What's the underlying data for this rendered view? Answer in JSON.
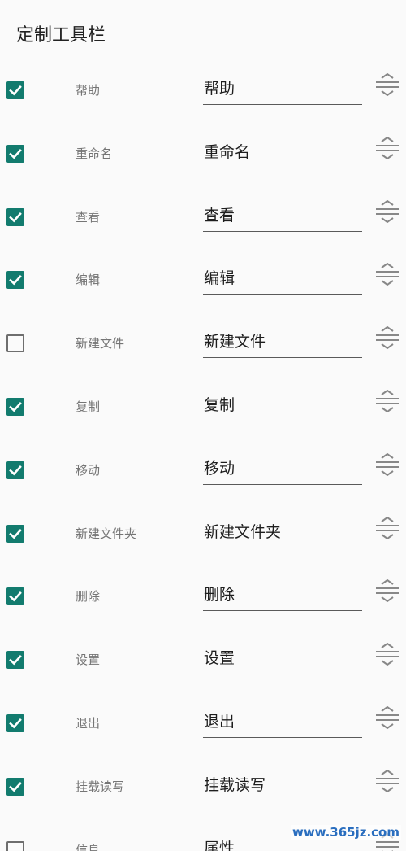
{
  "page": {
    "title": "定制工具栏"
  },
  "colors": {
    "accent": "#127b6e",
    "background": "#fafafa"
  },
  "items": [
    {
      "label": "帮助",
      "value": "帮助",
      "checked": true
    },
    {
      "label": "重命名",
      "value": "重命名",
      "checked": true
    },
    {
      "label": "查看",
      "value": "查看",
      "checked": true
    },
    {
      "label": "编辑",
      "value": "编辑",
      "checked": true
    },
    {
      "label": "新建文件",
      "value": "新建文件",
      "checked": false
    },
    {
      "label": "复制",
      "value": "复制",
      "checked": true
    },
    {
      "label": "移动",
      "value": "移动",
      "checked": true
    },
    {
      "label": "新建文件夹",
      "value": "新建文件夹",
      "checked": true
    },
    {
      "label": "删除",
      "value": "删除",
      "checked": true
    },
    {
      "label": "设置",
      "value": "设置",
      "checked": true
    },
    {
      "label": "退出",
      "value": "退出",
      "checked": true
    },
    {
      "label": "挂载读写",
      "value": "挂载读写",
      "checked": true
    },
    {
      "label": "信息",
      "value": "属性",
      "checked": false
    }
  ],
  "watermark": "www.365jz.com",
  "icons": {
    "drag": "drag-handle-icon",
    "check": "check-icon"
  }
}
